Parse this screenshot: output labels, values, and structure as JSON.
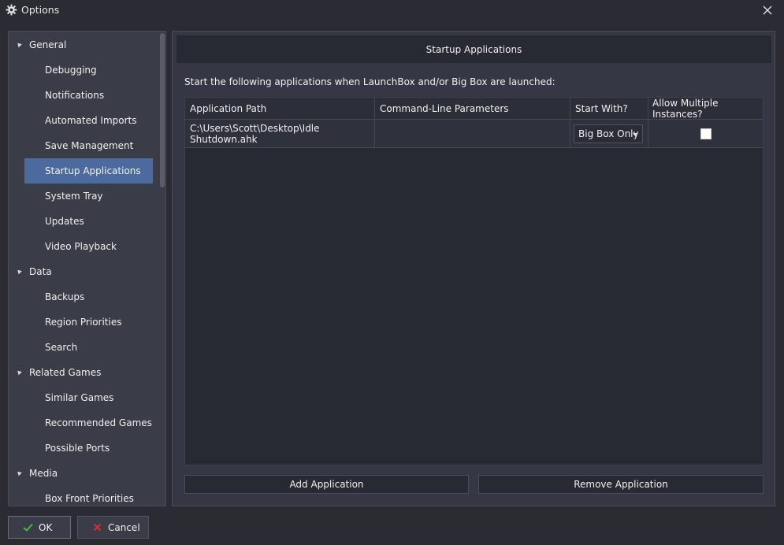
{
  "window": {
    "title": "Options",
    "icon": "gear-icon",
    "close_icon": "close-icon"
  },
  "sidebar": {
    "selected": "Startup Applications",
    "items": [
      {
        "label": "General",
        "level": 0,
        "expanded": true
      },
      {
        "label": "Debugging",
        "level": 1
      },
      {
        "label": "Notifications",
        "level": 1
      },
      {
        "label": "Automated Imports",
        "level": 1
      },
      {
        "label": "Save Management",
        "level": 1
      },
      {
        "label": "Startup Applications",
        "level": 1,
        "selected": true
      },
      {
        "label": "System Tray",
        "level": 1
      },
      {
        "label": "Updates",
        "level": 1
      },
      {
        "label": "Video Playback",
        "level": 1
      },
      {
        "label": "Data",
        "level": 0,
        "expanded": true
      },
      {
        "label": "Backups",
        "level": 1
      },
      {
        "label": "Region Priorities",
        "level": 1
      },
      {
        "label": "Search",
        "level": 1
      },
      {
        "label": "Related Games",
        "level": 0,
        "expanded": true
      },
      {
        "label": "Similar Games",
        "level": 1
      },
      {
        "label": "Recommended Games",
        "level": 1
      },
      {
        "label": "Possible Ports",
        "level": 1
      },
      {
        "label": "Media",
        "level": 0,
        "expanded": true
      },
      {
        "label": "Box Front Priorities",
        "level": 1
      }
    ]
  },
  "main": {
    "header": "Startup Applications",
    "description": "Start the following applications when LaunchBox and/or Big Box are launched:",
    "table": {
      "columns": [
        "Application Path",
        "Command-Line Parameters",
        "Start With?",
        "Allow Multiple Instances?"
      ],
      "rows": [
        {
          "path": "C:\\Users\\Scott\\Desktop\\Idle Shutdown.ahk",
          "params": "",
          "start_with": "Big Box Only",
          "allow_multiple": false
        }
      ]
    },
    "add_label": "Add Application",
    "remove_label": "Remove Application"
  },
  "footer": {
    "ok_label": "OK",
    "ok_icon": "checkmark-icon",
    "cancel_label": "Cancel",
    "cancel_icon": "x-icon"
  },
  "colors": {
    "accent": "#4d6a9f",
    "background": "#2a2b33",
    "panel": "#353744",
    "ok_check": "#3fbf3f",
    "cancel_x": "#d03030"
  }
}
